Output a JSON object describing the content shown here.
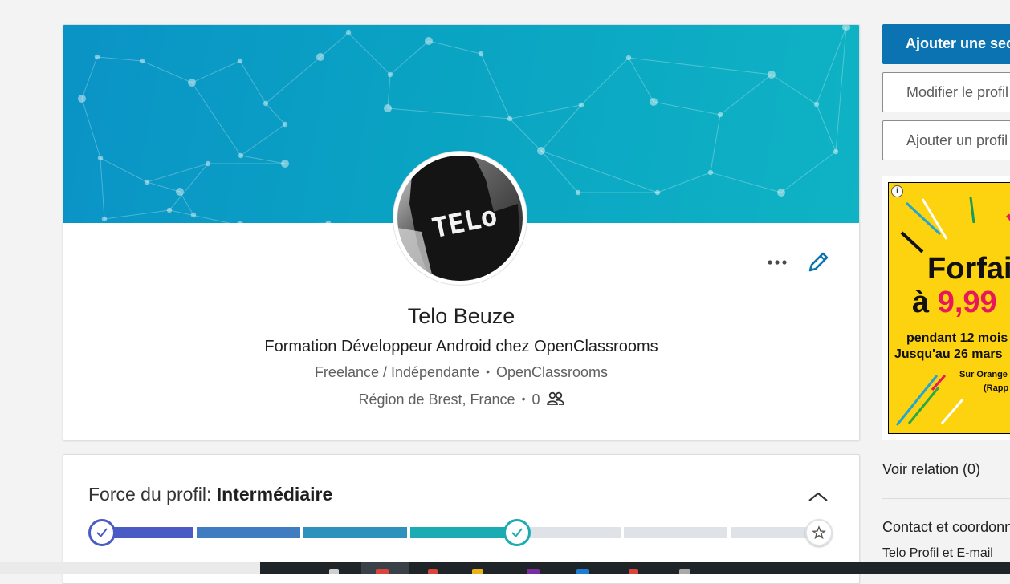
{
  "profile": {
    "name": "Telo Beuze",
    "headline": "Formation Développeur Android chez OpenClassrooms",
    "position": "Freelance / Indépendante",
    "company": "OpenClassrooms",
    "location": "Région de Brest, France",
    "connections_count": "0",
    "avatar_text": "TELo"
  },
  "strength": {
    "label": "Force du profil:",
    "level": "Intermédiaire",
    "progress_fraction": 0.57
  },
  "sidebar": {
    "primary_button": "Ajouter une section au profil",
    "edit_button": "Modifier le profil public",
    "add_button": "Ajouter un profil dans une autre langue",
    "see_connections": "Voir relation (0)",
    "contact_title": "Contact et coordonnées",
    "contact_sub": "Telo Profil et E-mail"
  },
  "ad": {
    "info": "i",
    "line1": "Forfait",
    "line2_prefix": "à",
    "price": "9,99",
    "line3": "pendant 12 mois",
    "line4": "Jusqu'au 26 mars",
    "line5": "Sur Orange",
    "line6": "(Rapp"
  },
  "colors": {
    "accent": "#0b73b1",
    "banner_start": "#0a93c6",
    "banner_end": "#0fb3c4",
    "progress_complete": "#4a5bc4",
    "progress_teal": "#1aacb2",
    "progress_empty": "#dfe3e7",
    "ad_yellow": "#fdd20f"
  }
}
